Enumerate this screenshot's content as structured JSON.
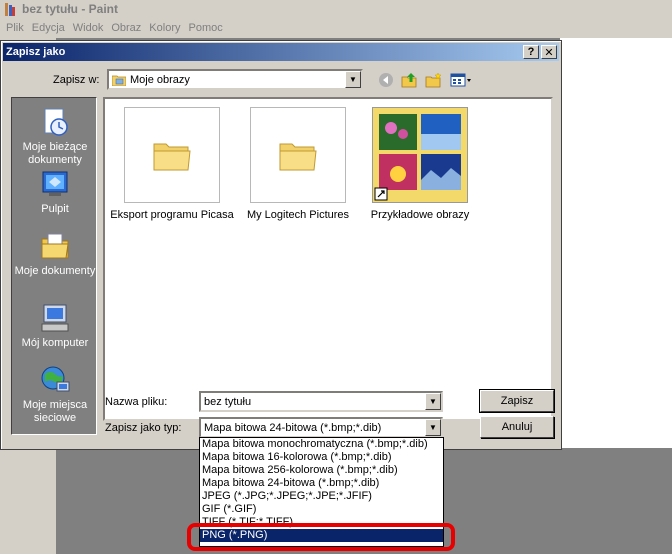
{
  "paint": {
    "title": "bez tytułu - Paint",
    "menu": [
      "Plik",
      "Edycja",
      "Widok",
      "Obraz",
      "Kolory",
      "Pomoc"
    ]
  },
  "dialog": {
    "title": "Zapisz jako",
    "help_label": "?",
    "close_label": "✕",
    "save_in_label": "Zapisz w:",
    "save_in_value": "Moje obrazy",
    "places": [
      {
        "label": "Moje bieżące dokumenty",
        "icon": "recent-documents-icon"
      },
      {
        "label": "Pulpit",
        "icon": "desktop-icon"
      },
      {
        "label": "Moje dokumenty",
        "icon": "my-documents-icon"
      },
      {
        "label": "Mój komputer",
        "icon": "my-computer-icon"
      },
      {
        "label": "Moje miejsca sieciowe",
        "icon": "network-places-icon"
      }
    ],
    "files": [
      {
        "name": "Eksport programu Picasa",
        "icon": "folder-icon"
      },
      {
        "name": "My Logitech Pictures",
        "icon": "folder-icon"
      },
      {
        "name": "Przykładowe obrazy",
        "icon": "sample-pictures-folder-icon"
      }
    ],
    "filename_label": "Nazwa pliku:",
    "filename_value": "bez tytułu",
    "filetype_label": "Zapisz jako typ:",
    "filetype_value": "Mapa bitowa 24-bitowa (*.bmp;*.dib)",
    "save_button": "Zapisz",
    "cancel_button": "Anuluj",
    "filetype_options": [
      "Mapa bitowa monochromatyczna (*.bmp;*.dib)",
      "Mapa bitowa 16-kolorowa  (*.bmp;*.dib)",
      "Mapa bitowa 256-kolorowa (*.bmp;*.dib)",
      "Mapa bitowa 24-bitowa (*.bmp;*.dib)",
      "JPEG (*.JPG;*.JPEG;*.JPE;*.JFIF)",
      "GIF (*.GIF)",
      "TIFF (*.TIF;*.TIFF)",
      "PNG (*.PNG)"
    ],
    "selected_option_index": 7
  },
  "colors": {
    "titlebar_active": "#0a246a",
    "selection": "#0a246a",
    "highlight_ring": "#e80000",
    "face": "#d4d0c8"
  }
}
